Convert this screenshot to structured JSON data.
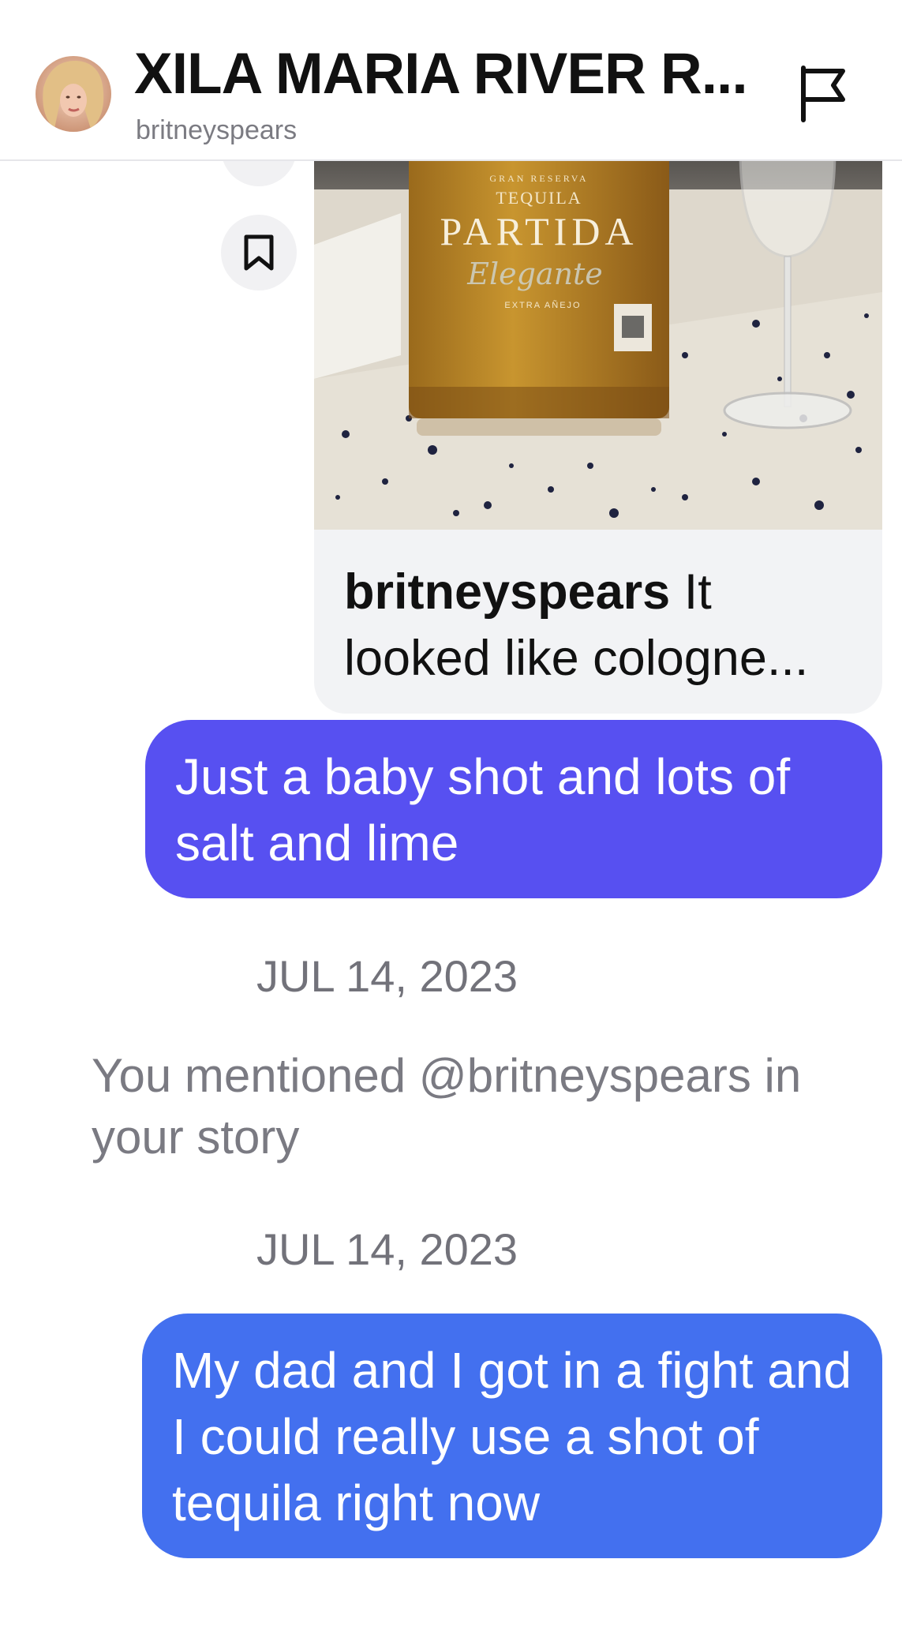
{
  "header": {
    "title": "XILA MARIA RIVER R...",
    "username": "britneyspears"
  },
  "shared_post": {
    "image": {
      "label_top": "GRAN RESERVA",
      "label_mid": "TEQUILA",
      "brand": "PARTIDA",
      "script": "Elegante",
      "sub": "EXTRA AÑEJO"
    },
    "caption_user": "britneyspears",
    "caption_text": "It looked like cologne..."
  },
  "messages": [
    {
      "text": "Just a baby shot and lots of salt and lime"
    },
    {
      "date": "JUL 14, 2023"
    },
    {
      "text": "You mentioned @britneyspears in your story"
    },
    {
      "date": "JUL 14, 2023"
    },
    {
      "text": "My dad and I got in a fight and I could really use a shot of tequila right now"
    }
  ],
  "colors": {
    "bubble_purple": "#5750f1",
    "bubble_blue": "#4370ef",
    "muted_text": "#7a7a82"
  },
  "icons": [
    "flag-icon",
    "bookmark-icon"
  ]
}
